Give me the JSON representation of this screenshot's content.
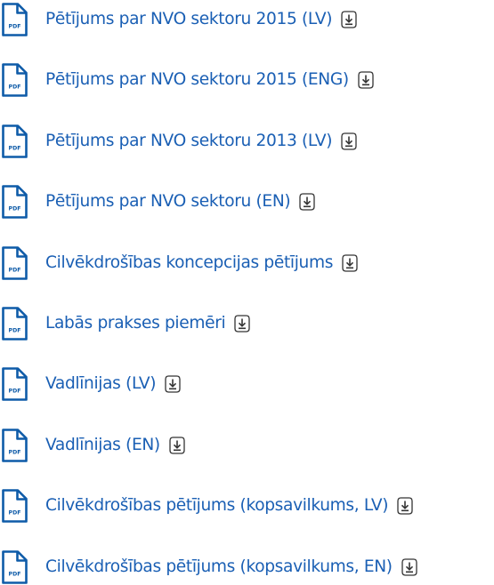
{
  "colors": {
    "link": "#1a5fb4",
    "icon": "#0e5ba8"
  },
  "icons": {
    "file": "pdf-file-icon",
    "download": "download-icon"
  },
  "pdf_badge_text": "PDF",
  "documents": [
    {
      "label": "Pētījums par NVO sektoru 2015 (LV)"
    },
    {
      "label": "Pētījums par NVO sektoru 2015 (ENG)"
    },
    {
      "label": "Pētījums par NVO sektoru 2013 (LV)"
    },
    {
      "label": "Pētījums par NVO sektoru (EN)"
    },
    {
      "label": "Cilvēkdrošības koncepcijas pētījums"
    },
    {
      "label": "Labās prakses piemēri"
    },
    {
      "label": "Vadlīnijas (LV)"
    },
    {
      "label": "Vadlīnijas (EN)"
    },
    {
      "label": "Cilvēkdrošības pētījums (kopsavilkums, LV)"
    },
    {
      "label": "Cilvēkdrošības pētījums (kopsavilkums, EN)"
    }
  ]
}
